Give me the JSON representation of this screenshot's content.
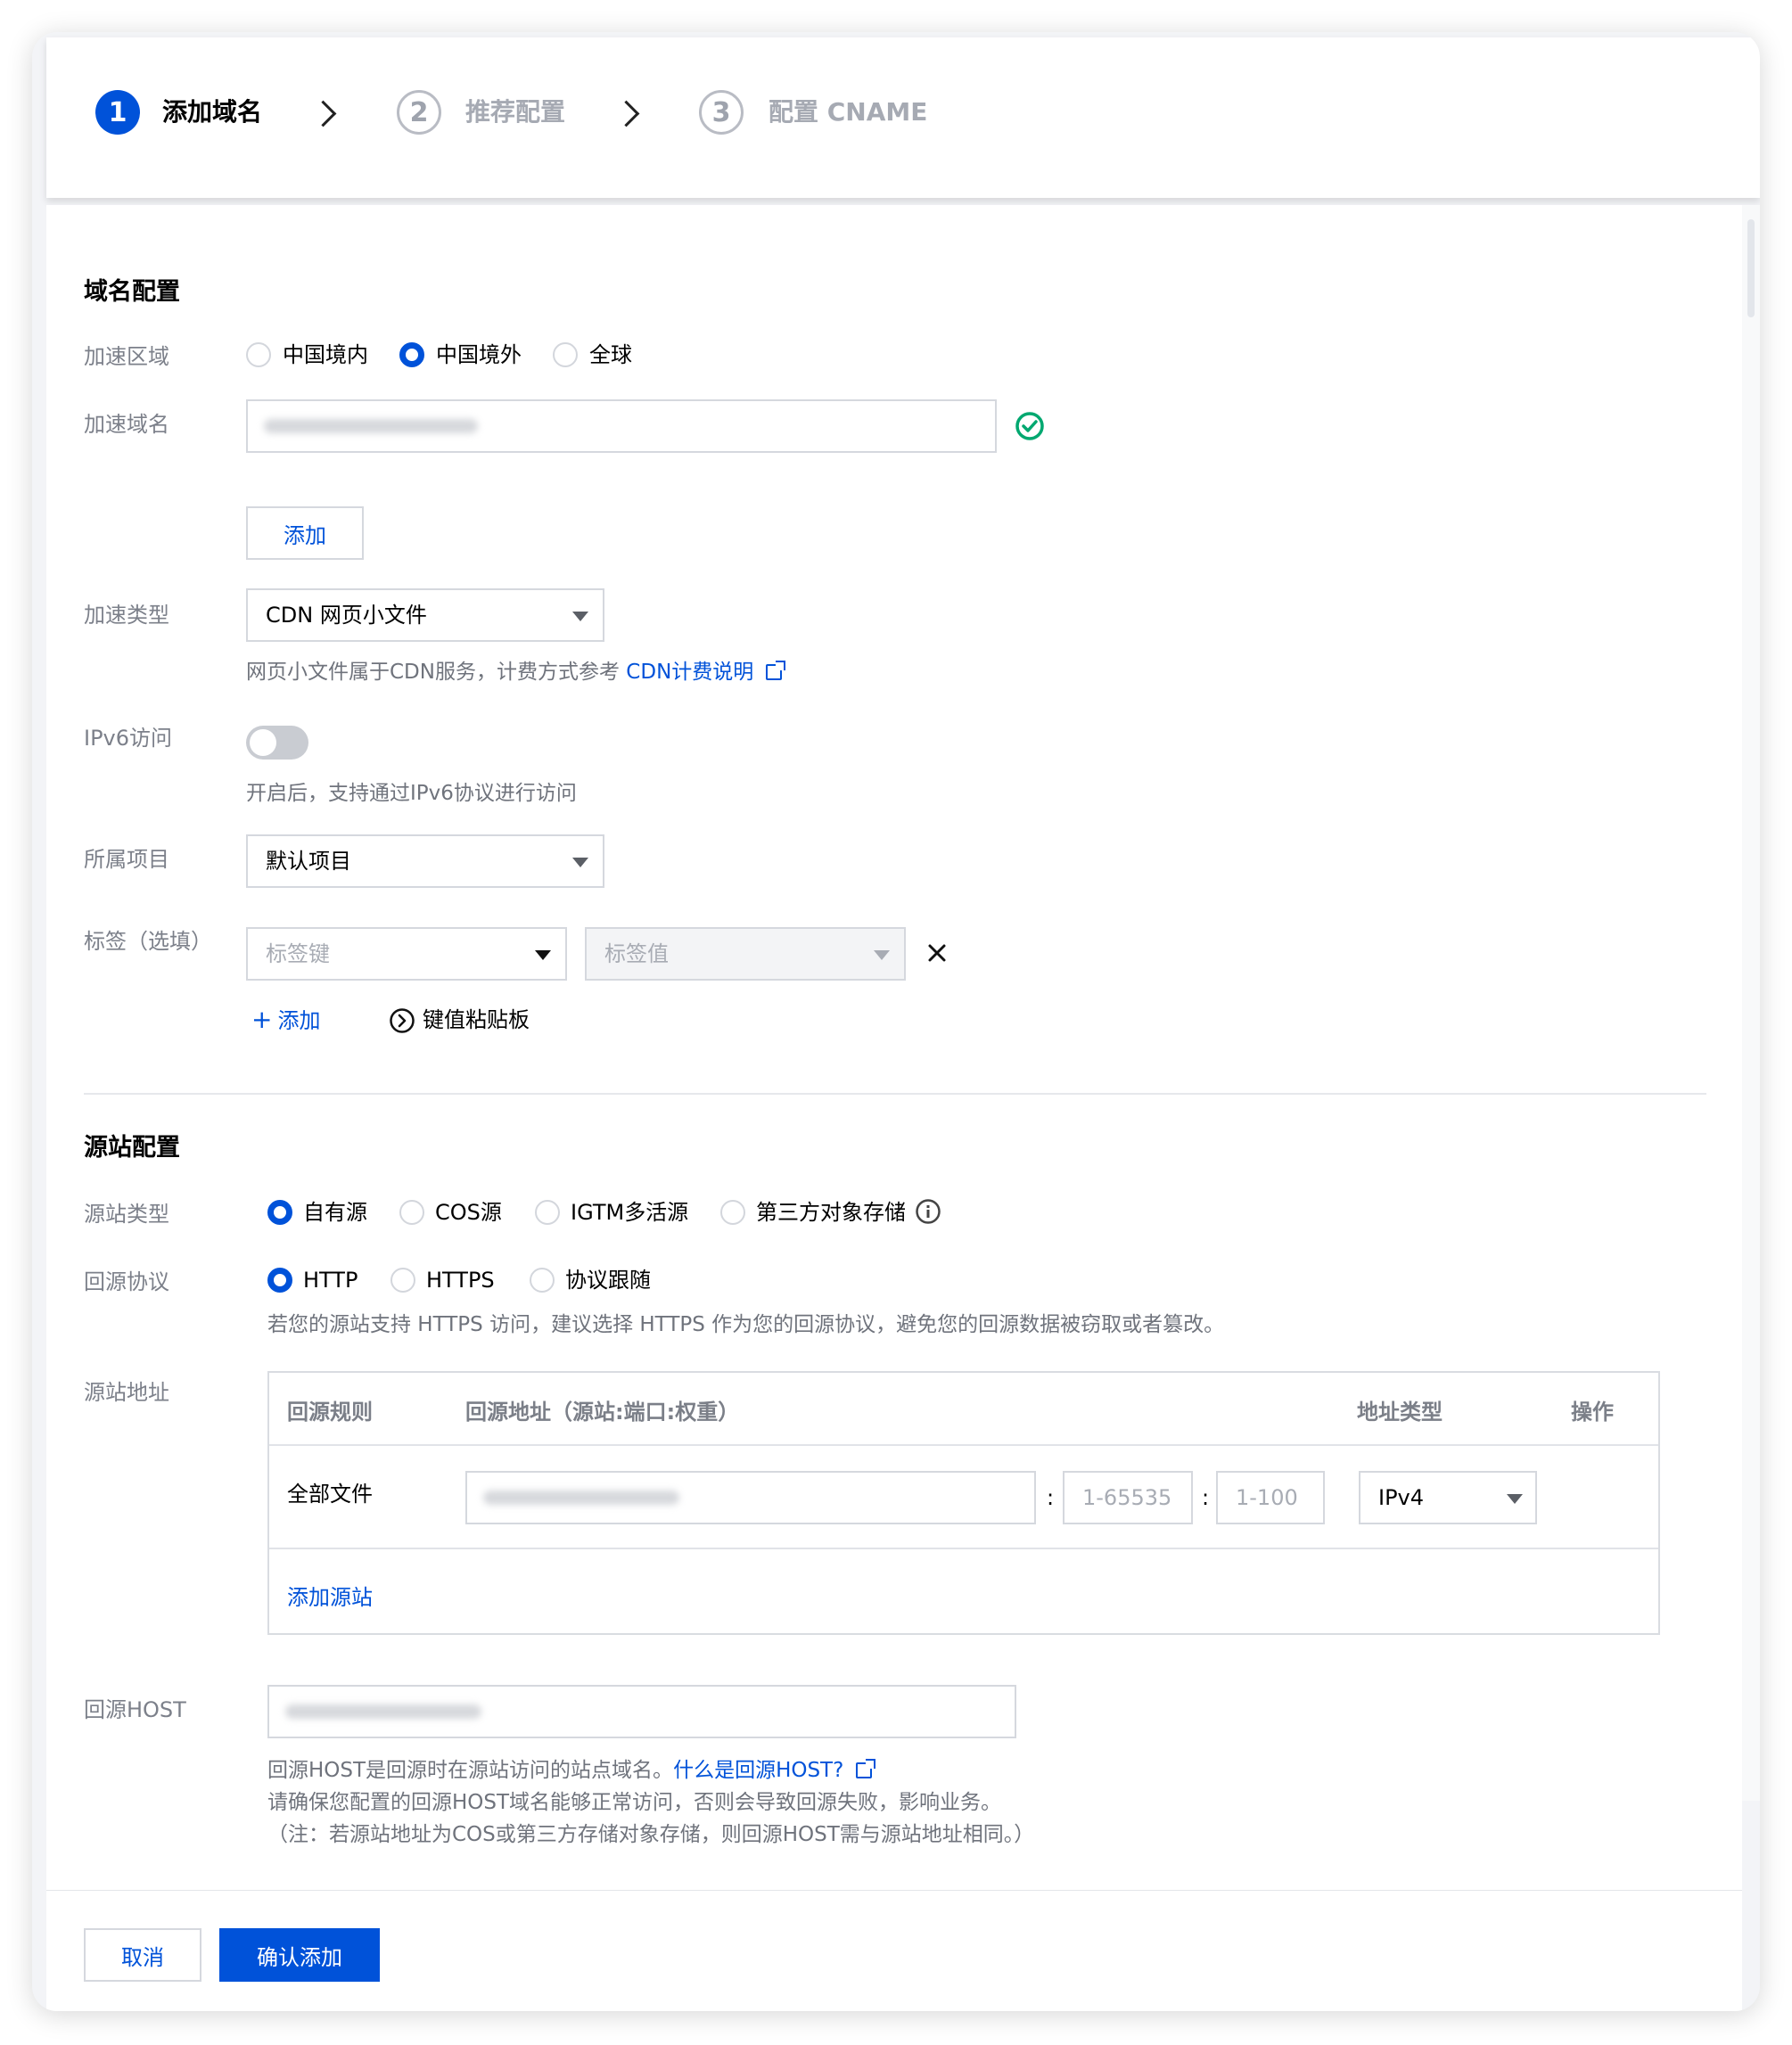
{
  "steps": [
    {
      "num": "1",
      "label": "添加域名",
      "state": "active"
    },
    {
      "num": "2",
      "label": "推荐配置",
      "state": "inactive"
    },
    {
      "num": "3",
      "label": "配置 CNAME",
      "state": "inactive"
    }
  ],
  "domain_config": {
    "title": "域名配置",
    "accel_region": {
      "label": "加速区域",
      "options": [
        "中国境内",
        "中国境外",
        "全球"
      ],
      "selected": "中国境外"
    },
    "accel_domain": {
      "label": "加速域名",
      "value": ""
    },
    "add_button": "添加",
    "accel_type": {
      "label": "加速类型",
      "value": "CDN 网页小文件",
      "help_text": "网页小文件属于CDN服务，计费方式参考 ",
      "help_link": "CDN计费说明"
    },
    "ipv6": {
      "label": "IPv6访问",
      "enabled": false,
      "help_text": "开启后，支持通过IPv6协议进行访问"
    },
    "project": {
      "label": "所属项目",
      "value": "默认项目"
    },
    "tags": {
      "label": "标签（选填）",
      "key_placeholder": "标签键",
      "value_placeholder": "标签值",
      "add_label": "添加",
      "clipboard_label": "键值粘贴板"
    }
  },
  "origin_config": {
    "title": "源站配置",
    "origin_type": {
      "label": "源站类型",
      "options": [
        "自有源",
        "COS源",
        "IGTM多活源",
        "第三方对象存储"
      ],
      "selected": "自有源"
    },
    "origin_protocol": {
      "label": "回源协议",
      "options": [
        "HTTP",
        "HTTPS",
        "协议跟随"
      ],
      "selected": "HTTP",
      "help_text": "若您的源站支持 HTTPS 访问，建议选择 HTTPS 作为您的回源协议，避免您的回源数据被窃取或者篡改。"
    },
    "origin_address": {
      "label": "源站地址",
      "columns": [
        "回源规则",
        "回源地址（源站:端口:权重）",
        "地址类型",
        "操作"
      ],
      "rows": [
        {
          "rule": "全部文件",
          "address": "",
          "port_placeholder": "1-65535",
          "weight_placeholder": "1-100",
          "address_type": "IPv4"
        }
      ],
      "add_origin_label": "添加源站"
    },
    "origin_host": {
      "label": "回源HOST",
      "value": "",
      "help_line1": "回源HOST是回源时在源站访问的站点域名。",
      "help_link": "什么是回源HOST?",
      "help_line2": "请确保您配置的回源HOST域名能够正常访问，否则会导致回源失败，影响业务。",
      "help_line3": "（注：若源站地址为COS或第三方存储对象存储，则回源HOST需与源站地址相同。）"
    }
  },
  "footer": {
    "cancel": "取消",
    "confirm": "确认添加"
  },
  "colors": {
    "primary": "#0052d9",
    "success": "#00a870",
    "muted": "#7c808a"
  }
}
